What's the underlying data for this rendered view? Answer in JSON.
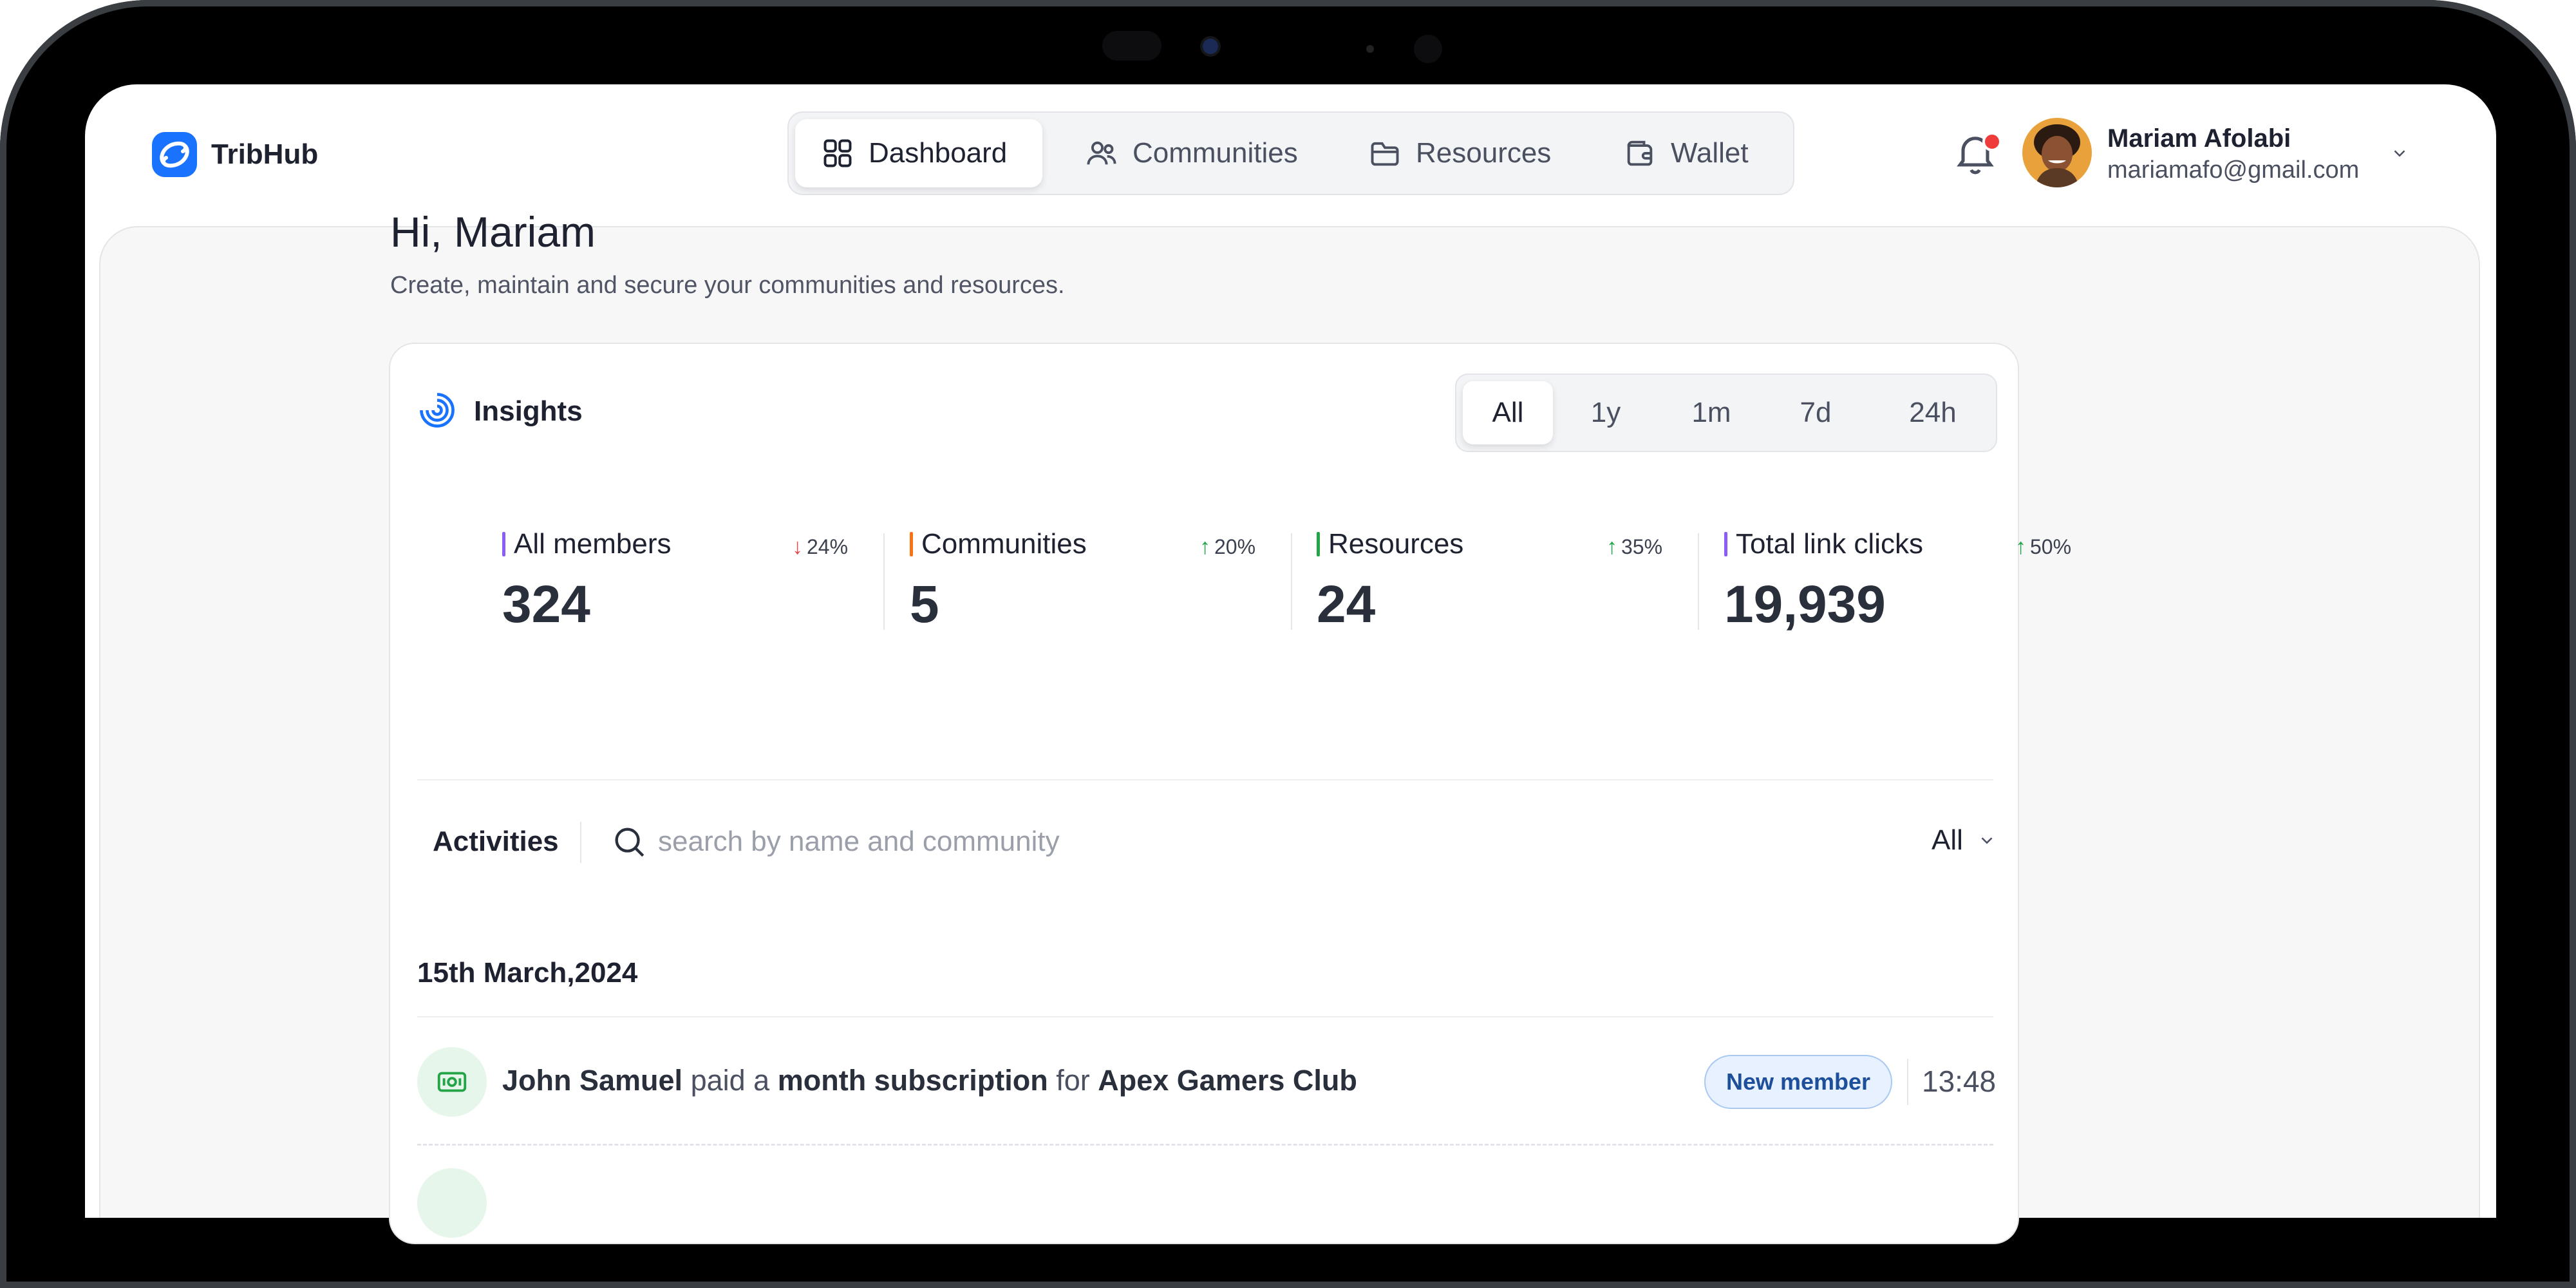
{
  "app": {
    "name": "TribHub",
    "brand_color": "#1a73ff"
  },
  "nav": {
    "items": [
      {
        "label": "Dashboard",
        "icon": "grid-icon",
        "active": true
      },
      {
        "label": "Communities",
        "icon": "users-icon",
        "active": false
      },
      {
        "label": "Resources",
        "icon": "folder-icon",
        "active": false
      },
      {
        "label": "Wallet",
        "icon": "wallet-icon",
        "active": false
      }
    ]
  },
  "user": {
    "name": "Mariam Afolabi",
    "email": "mariamafo@gmail.com",
    "has_notifications": true
  },
  "header": {
    "greeting": "Hi, Mariam",
    "subtitle": "Create, maintain and secure your communities and resources."
  },
  "insights": {
    "title": "Insights",
    "ranges": [
      "All",
      "1y",
      "1m",
      "7d",
      "24h"
    ],
    "selected_range": "All",
    "stats": [
      {
        "label": "All members",
        "value": "324",
        "change": "24%",
        "direction": "down",
        "accent": "#8b5cf6",
        "change_color": "#e5484d"
      },
      {
        "label": "Communities",
        "value": "5",
        "change": "20%",
        "direction": "up",
        "accent": "#f97316",
        "change_color": "#22a447"
      },
      {
        "label": "Resources",
        "value": "24",
        "change": "35%",
        "direction": "up",
        "accent": "#22a447",
        "change_color": "#22a447"
      },
      {
        "label": "Total link clicks",
        "value": "19,939",
        "change": "50%",
        "direction": "up",
        "accent": "#8b5cf6",
        "change_color": "#22a447"
      }
    ]
  },
  "activities": {
    "title": "Activities",
    "search_placeholder": "search by name and community",
    "filter_value": "All",
    "groups": [
      {
        "date": "15th March,2024",
        "items": [
          {
            "actor": "John Samuel",
            "verb1": "paid a",
            "object": "month subscription",
            "verb2": "for",
            "target": "Apex Gamers Club",
            "badge": "New member",
            "time": "13:48",
            "icon": "money-icon"
          }
        ]
      }
    ]
  }
}
